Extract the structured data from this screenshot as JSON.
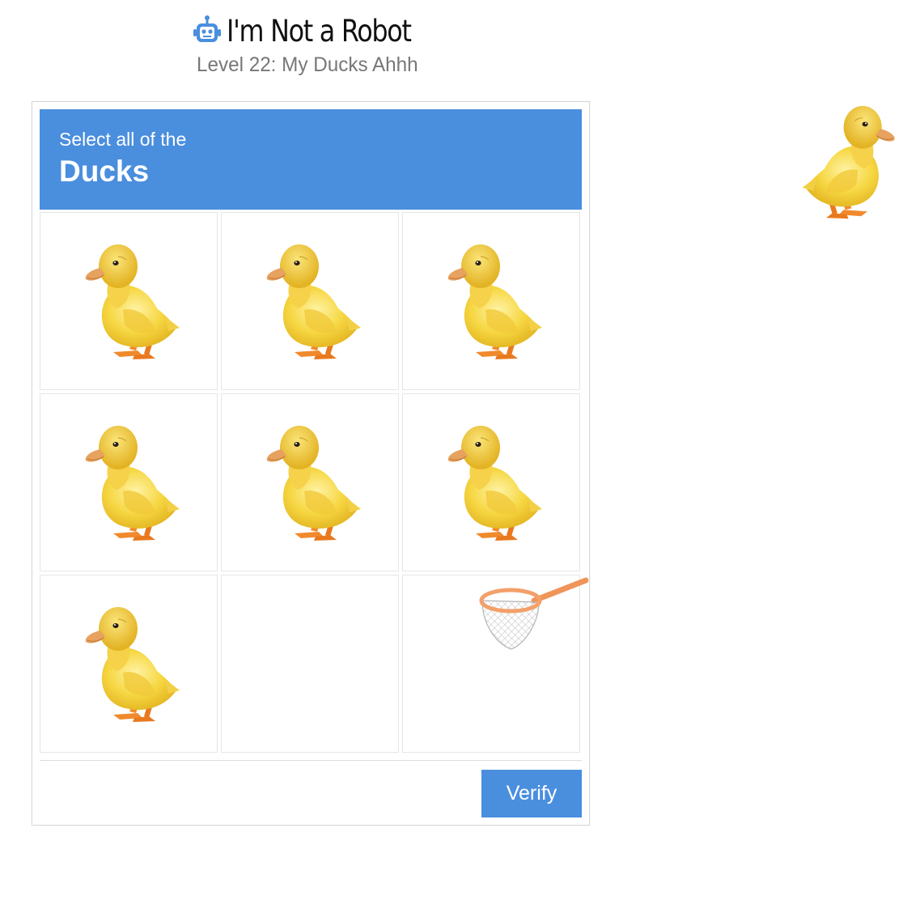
{
  "header": {
    "icon": "robot-icon",
    "title": "I'm Not a Robot",
    "subtitle": "Level 22: My Ducks Ahhh"
  },
  "captcha": {
    "instruction": "Select all of the",
    "target": "Ducks",
    "tiles": [
      {
        "content": "duckling"
      },
      {
        "content": "duckling"
      },
      {
        "content": "duckling"
      },
      {
        "content": "duckling"
      },
      {
        "content": "duckling"
      },
      {
        "content": "duckling"
      },
      {
        "content": "duckling"
      },
      {
        "content": "empty"
      },
      {
        "content": "empty"
      }
    ],
    "verify_label": "Verify"
  },
  "tools": {
    "net": "fishing-net-icon"
  },
  "escaped_duck": "duckling",
  "colors": {
    "accent": "#4a8ede",
    "duck_body": "#f6d743",
    "duck_feet": "#f08a2c",
    "net_rim": "#f3a06a"
  }
}
